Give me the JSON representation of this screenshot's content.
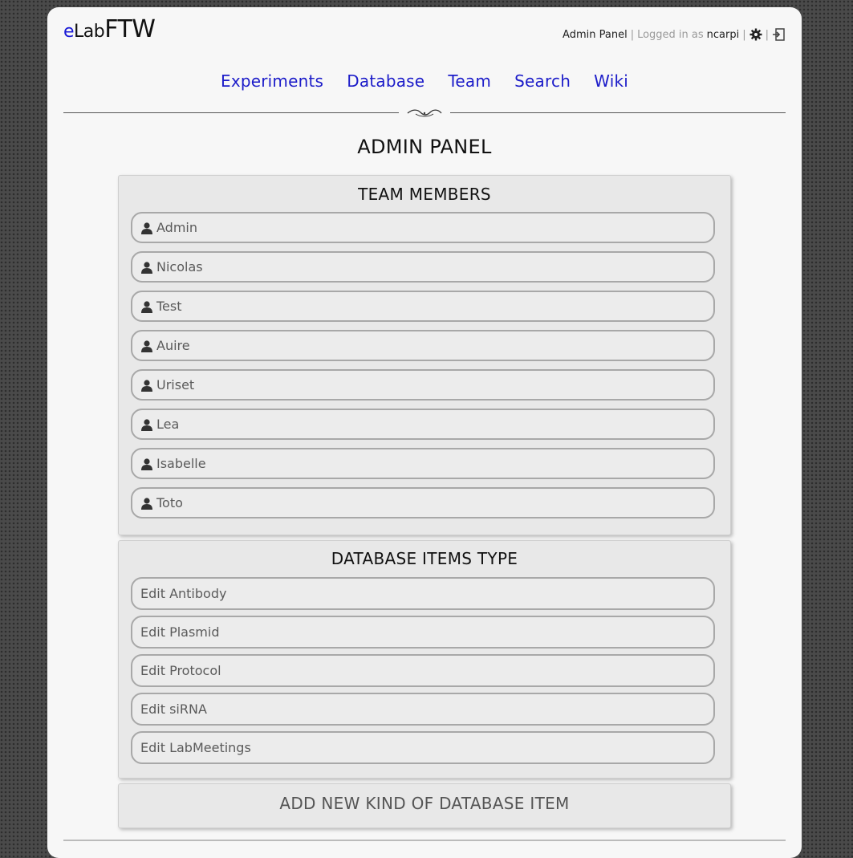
{
  "header": {
    "logo_e": "e",
    "logo_lab": "Lab",
    "logo_ftw": "FTW",
    "admin_panel_link": "Admin Panel",
    "separator": "|",
    "logged_in_as": "Logged in as",
    "username": "ncarpi",
    "icons": [
      "gear-icon",
      "logout-icon"
    ]
  },
  "nav": {
    "items": [
      {
        "label": "Experiments"
      },
      {
        "label": "Database"
      },
      {
        "label": "Team"
      },
      {
        "label": "Search"
      },
      {
        "label": "Wiki"
      }
    ]
  },
  "page_title": "ADMIN PANEL",
  "team_members": {
    "title": "TEAM MEMBERS",
    "members": [
      "Admin",
      "Nicolas",
      "Test",
      "Auire",
      "Uriset",
      "Lea",
      "Isabelle",
      "Toto"
    ]
  },
  "database_items_type": {
    "title": "DATABASE ITEMS TYPE",
    "items": [
      "Edit Antibody",
      "Edit Plasmid",
      "Edit Protocol",
      "Edit siRNA",
      "Edit LabMeetings"
    ]
  },
  "add_new": {
    "label": "ADD NEW KIND OF DATABASE ITEM"
  },
  "colors": {
    "link_blue": "#1c1cc9",
    "logo_e_blue": "#1a1ad6",
    "panel_bg": "#e8e8e8",
    "page_bg": "#f7f7f7"
  }
}
